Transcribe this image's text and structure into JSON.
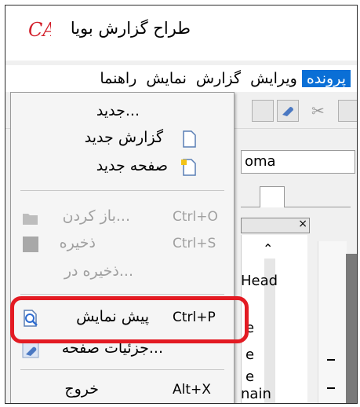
{
  "window": {
    "title": "طراح گزارش بویا"
  },
  "menubar": {
    "items": [
      {
        "label": "پرونده",
        "active": true
      },
      {
        "label": "ویرایش",
        "active": false
      },
      {
        "label": "گزارش",
        "active": false
      },
      {
        "label": "نمایش",
        "active": false
      },
      {
        "label": "راهنما",
        "active": false
      }
    ]
  },
  "toolbar": {
    "font_value": "oma"
  },
  "background": {
    "partial_labels": [
      "Head",
      "e",
      "e",
      "e",
      "nain"
    ]
  },
  "file_menu": {
    "items": [
      {
        "label": "...جدید",
        "accel": "",
        "enabled": true,
        "icon": "none"
      },
      {
        "label": "گزارش جدید",
        "accel": "",
        "enabled": true,
        "icon": "new-report-icon"
      },
      {
        "label": "صفحه جدید",
        "accel": "",
        "enabled": true,
        "icon": "new-page-icon"
      },
      {
        "label": "...باز کردن",
        "accel": "Ctrl+O",
        "enabled": false,
        "icon": "open-folder-icon"
      },
      {
        "label": "ذخیره",
        "accel": "Ctrl+S",
        "enabled": false,
        "icon": "save-icon"
      },
      {
        "label": "...ذخیره در",
        "accel": "",
        "enabled": false,
        "icon": "none"
      },
      {
        "label": "پیش نمایش",
        "accel": "Ctrl+P",
        "enabled": true,
        "icon": "preview-icon"
      },
      {
        "label": "...جزئیات صفحه",
        "accel": "",
        "enabled": true,
        "icon": "page-details-icon"
      },
      {
        "label": "خروج",
        "accel": "Alt+X",
        "enabled": true,
        "icon": "none"
      }
    ]
  },
  "colors": {
    "menu_active": "#0a6fd6",
    "highlight_ring": "#e31b23",
    "logo_red": "#d21f2a"
  }
}
